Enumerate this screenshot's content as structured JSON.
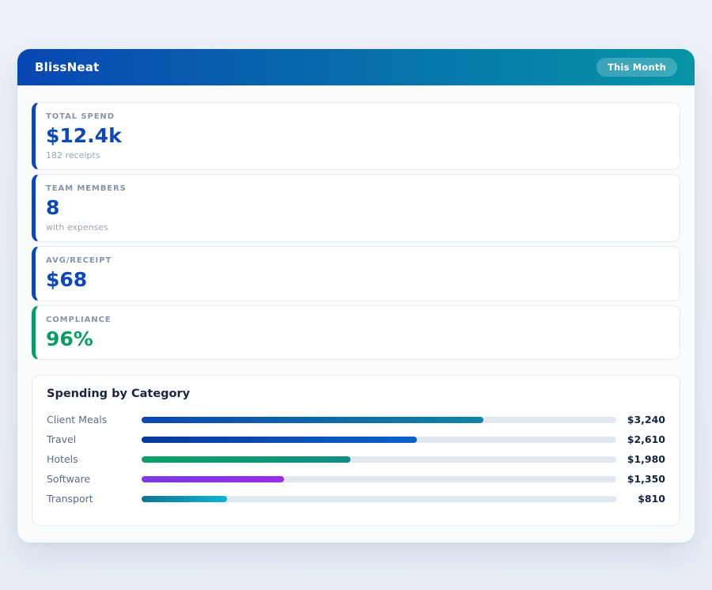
{
  "app": {
    "title": "BlissNeat",
    "period_badge": "This Month"
  },
  "theme": {
    "page_bg": "#eef1f7",
    "panel_bg": "#f9fbfd",
    "header_gradient": [
      "#0846b2",
      "#0695a6"
    ],
    "badge_bg": "rgba(255,255,255,0.22)",
    "accent_blue": "#0d47b8",
    "accent_green": "#0a9d62",
    "track_color": "#e3e8f0"
  },
  "stats": [
    {
      "label": "TOTAL SPEND",
      "value": "$12.4k",
      "sub": "182 receipts",
      "accent": "#0d47b8"
    },
    {
      "label": "TEAM MEMBERS",
      "value": "8",
      "sub": "with expenses",
      "accent": "#0d47b8"
    },
    {
      "label": "AVG/RECEIPT",
      "value": "$68",
      "sub": "",
      "accent": "#0d47b8"
    },
    {
      "label": "COMPLIANCE",
      "value": "96%",
      "sub": "",
      "accent": "#0a9d62"
    }
  ],
  "chart_data": {
    "type": "bar",
    "orientation": "horizontal",
    "title": "Spending by Category",
    "categories": [
      "Client Meals",
      "Travel",
      "Hotels",
      "Software",
      "Transport"
    ],
    "values": [
      3240,
      2610,
      1980,
      1350,
      810
    ],
    "value_labels": [
      "$3,240",
      "$2,610",
      "$1,980",
      "$1,350",
      "$810"
    ],
    "xlim": [
      0,
      4500
    ],
    "grid": false,
    "legend": false,
    "bar_gradients": [
      [
        "#0a46b4",
        "#0e86a4"
      ],
      [
        "#07399c",
        "#0b62cc"
      ],
      [
        "#07a167",
        "#108e84"
      ],
      [
        "#7a3ae2",
        "#9c2ce8"
      ],
      [
        "#0e7490",
        "#0cb5d6"
      ]
    ]
  }
}
